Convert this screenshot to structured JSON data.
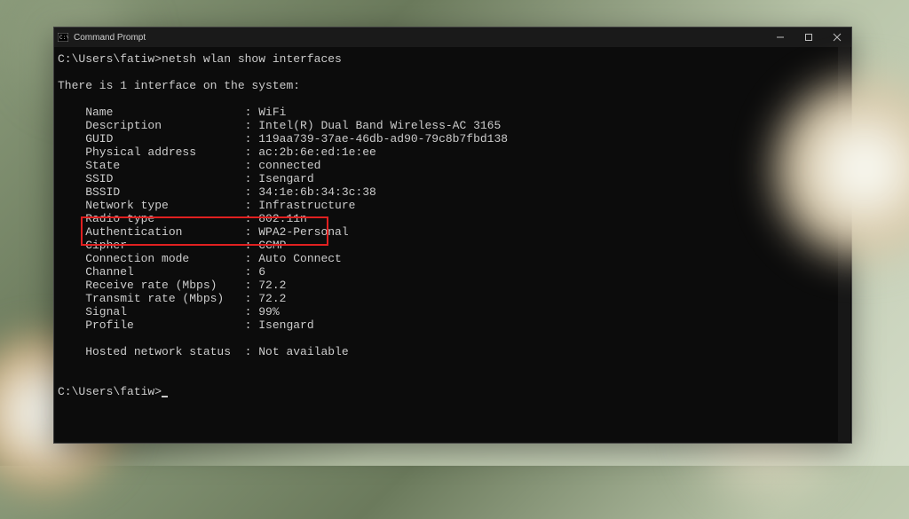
{
  "window": {
    "title": "Command Prompt"
  },
  "terminal": {
    "prompt1": "C:\\Users\\fatiw>",
    "command": "netsh wlan show interfaces",
    "blank": "",
    "summary": "There is 1 interface on the system:",
    "lines": [
      {
        "label": "Name",
        "value": "WiFi"
      },
      {
        "label": "Description",
        "value": "Intel(R) Dual Band Wireless-AC 3165"
      },
      {
        "label": "GUID",
        "value": "119aa739-37ae-46db-ad90-79c8b7fbd138"
      },
      {
        "label": "Physical address",
        "value": "ac:2b:6e:ed:1e:ee"
      },
      {
        "label": "State",
        "value": "connected"
      },
      {
        "label": "SSID",
        "value": "Isengard"
      },
      {
        "label": "BSSID",
        "value": "34:1e:6b:34:3c:38"
      },
      {
        "label": "Network type",
        "value": "Infrastructure"
      },
      {
        "label": "Radio type",
        "value": "802.11n"
      },
      {
        "label": "Authentication",
        "value": "WPA2-Personal"
      },
      {
        "label": "Cipher",
        "value": "CCMP"
      },
      {
        "label": "Connection mode",
        "value": "Auto Connect"
      },
      {
        "label": "Channel",
        "value": "6"
      },
      {
        "label": "Receive rate (Mbps)",
        "value": "72.2"
      },
      {
        "label": "Transmit rate (Mbps)",
        "value": "72.2"
      },
      {
        "label": "Signal",
        "value": "99%"
      },
      {
        "label": "Profile",
        "value": "Isengard"
      }
    ],
    "hosted": {
      "label": "Hosted network status",
      "value": "Not available"
    },
    "prompt2": "C:\\Users\\fatiw>"
  },
  "highlight": {
    "line_index": 9
  }
}
